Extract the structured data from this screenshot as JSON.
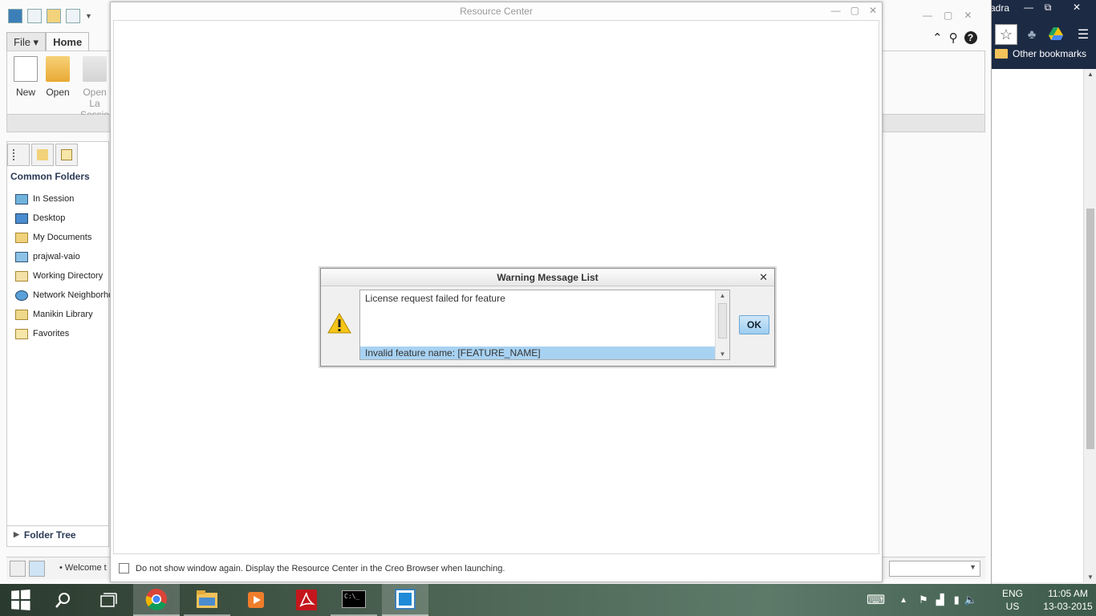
{
  "chrome": {
    "title_fragment": "adra",
    "bookmarks_label": "Other bookmarks",
    "btn_min": "—",
    "btn_restore": "⧉",
    "btn_close": "✕"
  },
  "creo": {
    "ribbon_tabs": [
      "File ▾",
      "Home"
    ],
    "buttons": {
      "new": "New",
      "open": "Open",
      "open_last_line1": "Open La",
      "open_last_line2": "Sessio"
    },
    "common_folders_title": "Common Folders",
    "folders": [
      "In Session",
      "Desktop",
      "My Documents",
      "prajwal-vaio",
      "Working Directory",
      "Network Neighborhood",
      "Manikin Library",
      "Favorites"
    ],
    "folder_tree_label": "Folder Tree",
    "status_text": "Welcome t",
    "win_min": "—",
    "win_max": "▢",
    "win_close": "✕"
  },
  "resource_center": {
    "title": "Resource Center",
    "checkbox_label": "Do not show window again. Display the Resource Center in the Creo Browser when launching.",
    "win_min": "—",
    "win_max": "▢",
    "win_close": "✕"
  },
  "dialog": {
    "title": "Warning Message List",
    "close": "✕",
    "messages": [
      "License request failed for feature",
      "Invalid feature name: [FEATURE_NAME]"
    ],
    "ok_label": "OK"
  },
  "taskbar": {
    "lang_line1": "ENG",
    "lang_line2": "US",
    "time": "11:05 AM",
    "date": "13-03-2015",
    "cmd_label": "C:\\_"
  },
  "colors": {
    "selection": "#a8d2f2",
    "chrome_dark": "#1c2a44",
    "ok_button": "#9dcdf0"
  }
}
